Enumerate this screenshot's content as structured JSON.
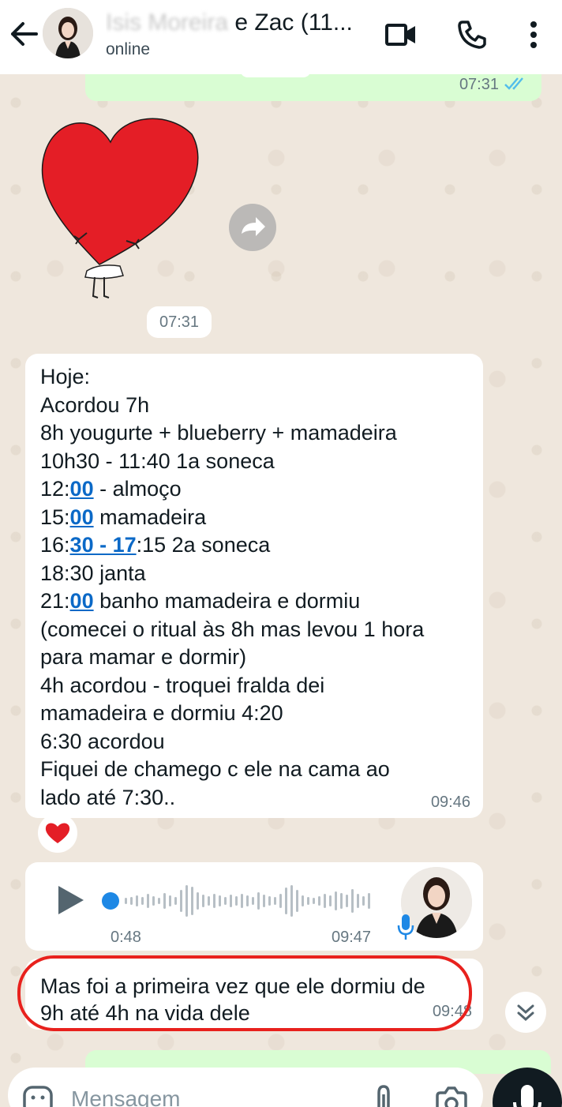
{
  "header": {
    "title_hidden": "Isis Moreira",
    "title_visible": "e Zac (11...",
    "status": "online"
  },
  "messages": {
    "top_outgoing_time": "07:31",
    "sticker_time": "07:31",
    "main": {
      "lines": [
        {
          "segments": [
            {
              "t": "Hoje:"
            }
          ]
        },
        {
          "segments": [
            {
              "t": "Acordou 7h"
            }
          ]
        },
        {
          "segments": [
            {
              "t": "8h yougurte + blueberry + mamadeira"
            }
          ]
        },
        {
          "segments": [
            {
              "t": "10h30 - 11:40 1a soneca"
            }
          ]
        },
        {
          "segments": [
            {
              "t": "12:"
            },
            {
              "t": "00",
              "link": true
            },
            {
              "t": " - almoço"
            }
          ]
        },
        {
          "segments": [
            {
              "t": "15:"
            },
            {
              "t": "00",
              "link": true
            },
            {
              "t": " mamadeira"
            }
          ]
        },
        {
          "segments": [
            {
              "t": "16:"
            },
            {
              "t": "30 - 17",
              "link": true
            },
            {
              "t": ":15 2a soneca"
            }
          ]
        },
        {
          "segments": [
            {
              "t": "18:30 janta"
            }
          ]
        },
        {
          "segments": [
            {
              "t": "21:"
            },
            {
              "t": "00",
              "link": true
            },
            {
              "t": " banho mamadeira e dormiu"
            }
          ]
        },
        {
          "segments": [
            {
              "t": "(comecei o ritual às 8h mas levou 1 hora"
            }
          ]
        },
        {
          "segments": [
            {
              "t": "para mamar e dormir)"
            }
          ]
        },
        {
          "segments": [
            {
              "t": "4h acordou - troquei fralda dei"
            }
          ]
        },
        {
          "segments": [
            {
              "t": "mamadeira e dormiu 4:20"
            }
          ]
        },
        {
          "segments": [
            {
              "t": "6:30 acordou"
            }
          ]
        },
        {
          "segments": [
            {
              "t": "Fiquei de chamego c ele na cama ao"
            }
          ]
        },
        {
          "segments": [
            {
              "t": "lado até 7:30.."
            }
          ]
        }
      ],
      "time": "09:46",
      "reaction": "❤️"
    },
    "audio": {
      "duration": "0:48",
      "time": "09:47",
      "progress": 0.0
    },
    "last": {
      "line1": "Mas foi a primeira vez que ele dormiu de",
      "line2": "9h até 4h na vida dele",
      "time": "09:48"
    }
  },
  "composer": {
    "placeholder": "Mensagem"
  },
  "icons": {
    "back": "arrow-left-icon",
    "video": "video-call-icon",
    "call": "phone-icon",
    "menu": "more-vert-icon",
    "forward": "forward-icon",
    "play": "play-icon",
    "mic": "mic-icon",
    "scroll": "chevron-double-down-icon",
    "emoji": "emoji-icon",
    "attach": "paperclip-icon",
    "camera": "camera-icon"
  },
  "colors": {
    "accent_link": "#0b69c7",
    "outgoing_bubble": "#d9fdd3",
    "tick_read": "#53bdeb",
    "highlight_ring": "#e8211d",
    "heart": "#e41e26"
  }
}
